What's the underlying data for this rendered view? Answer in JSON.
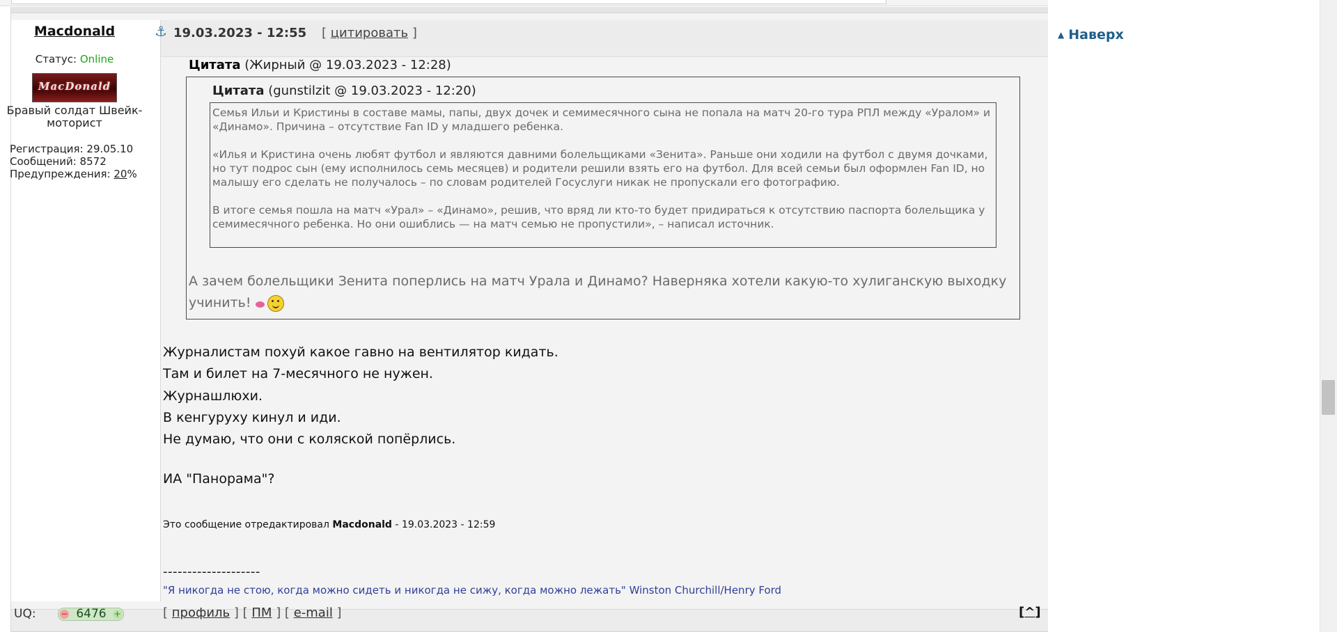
{
  "post": {
    "username": "Macdonald",
    "datetime": "19.03.2023 - 12:55",
    "quote_bracket_open": "[",
    "quote_link": "цитировать",
    "quote_bracket_close": "]"
  },
  "user": {
    "status_label": "Статус:",
    "status_value": "Online",
    "userpic_text": "MacDonald",
    "rank": "Бравый солдат Швейк-моторист",
    "reg_label": "Регистрация: 29.05.10",
    "posts_label": "Сообщений: 8572",
    "warn_label": "Предупреждения:",
    "warn_value": "20",
    "warn_suffix": "%"
  },
  "quote_outer": {
    "title_bold": "Цитата",
    "title_rest": "(Жирный @ 19.03.2023 - 12:28)",
    "reply_text": "А зачем болельщики Зенита поперлись на матч Урала и Динамо? Наверняка хотели какую-то хулиганскую выходку учинить!"
  },
  "quote_inner": {
    "title_bold": "Цитата",
    "title_rest": "(gunstilzit @ 19.03.2023 - 12:20)",
    "p1": "Семья Ильи и Кристины в составе мамы, папы, двух дочек и семимесячного сына не попала на матч 20-го тура РПЛ между «Уралом» и «Динамо». Причина – отсутствие Fan ID у младшего ребенка.",
    "p2": "«Илья и Кристина очень любят футбол и являются давними болельщиками «Зенита». Раньше они ходили на футбол с двумя дочками, но тут подрос сын (ему исполнилось семь месяцев) и родители решили взять его на футбол. Для всей семьи был оформлен Fan ID, но малышу его сделать не получалось – по словам родителей Госуслуги никак не пропускали его фотографию.",
    "p3": "В итоге семья пошла на матч «Урал» – «Динамо», решив, что вряд ли кто-то будет придираться к отсутствию паспорта болельщика у семимесячного ребенка. Но они ошиблись — на матч семью не пропустили», – написал источник."
  },
  "body": {
    "lines": [
      "Журналистам похуй какое гавно на вентилятор кидать.",
      "Там и билет на 7-месячного не нужен.",
      "Журнашлюхи.",
      "В кенгуруху кинул и иди.",
      "Не думаю, что они с коляской попёрлись."
    ],
    "agency": "ИА \"Панорама\"?",
    "edited_prefix": "Это сообщение отредактировал",
    "edited_user": "Macdonald",
    "edited_suffix": "- 19.03.2023 - 12:59",
    "separator": "--------------------",
    "signature": "\"Я никогда не стою, когда можно сидеть и никогда не сижу, когда можно лежать\" Winston Churchill/Henry Ford"
  },
  "footer": {
    "uq_label": "UQ:",
    "uq_value": "6476",
    "uq_minus": "−",
    "uq_plus": "+",
    "profile": "профиль",
    "pm": "ПМ",
    "email": "e-mail",
    "to_top": "^"
  },
  "sidebar": {
    "naverh": "Наверх"
  }
}
